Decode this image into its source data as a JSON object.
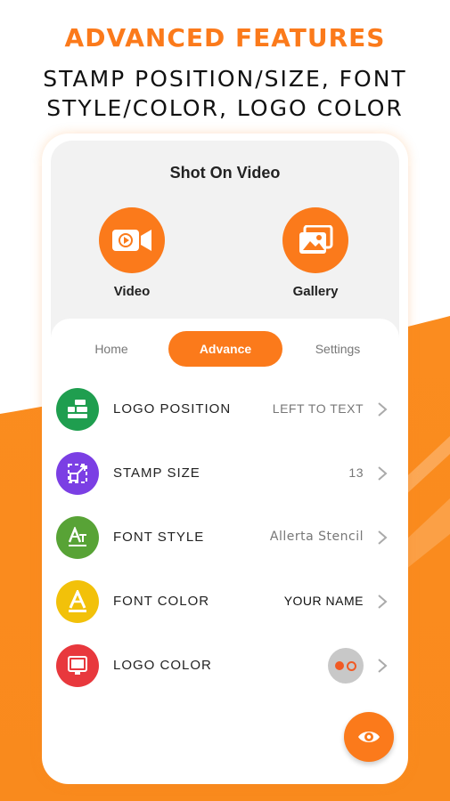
{
  "headline": "ADVANCED FEATURES",
  "subline": [
    "STAMP POSITION/SIZE, FONT",
    "STYLE/COLOR, LOGO COLOR"
  ],
  "app": {
    "title": "Shot On Video",
    "actions": [
      {
        "label": "Video",
        "icon": "video-camera-icon"
      },
      {
        "label": "Gallery",
        "icon": "gallery-icon"
      }
    ],
    "tabs": [
      {
        "label": "Home",
        "active": false
      },
      {
        "label": "Advance",
        "active": true
      },
      {
        "label": "Settings",
        "active": false
      }
    ],
    "settings": [
      {
        "label": "LOGO POSITION",
        "value": "LEFT TO TEXT",
        "icon": "logo-position-icon",
        "color": "#1f9e4f"
      },
      {
        "label": "STAMP SIZE",
        "value": "13",
        "icon": "stamp-size-icon",
        "color": "#7b3fe4"
      },
      {
        "label": "FONT STYLE",
        "value": "Allerta Stencil",
        "icon": "font-style-icon",
        "color": "#58a336"
      },
      {
        "label": "FONT COLOR",
        "value": "YOUR NAME",
        "icon": "font-color-icon",
        "color": "#f2c10a"
      },
      {
        "label": "LOGO COLOR",
        "value": "",
        "icon": "logo-color-icon",
        "color": "#e8383d"
      }
    ],
    "fab_icon": "eye-icon"
  },
  "colors": {
    "accent": "#fb7a1b",
    "swatch_color": "#f15a24"
  }
}
